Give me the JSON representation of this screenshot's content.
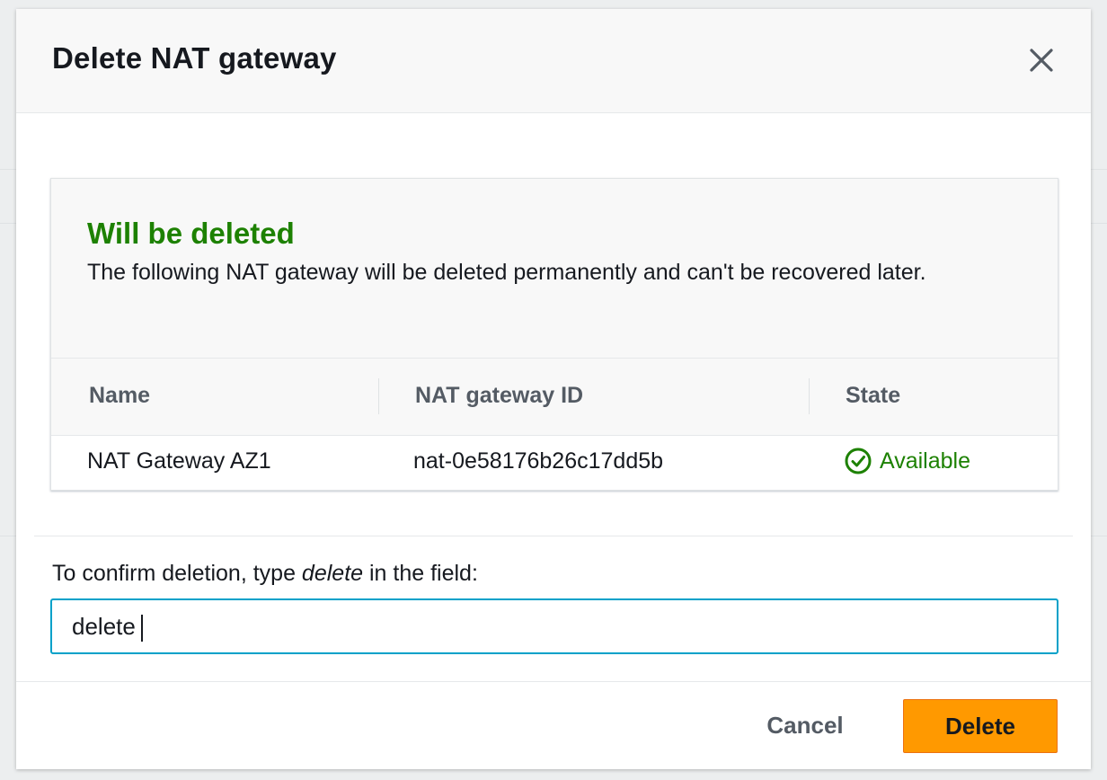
{
  "modal": {
    "title": "Delete NAT gateway",
    "close_icon": "close-icon"
  },
  "warning": {
    "heading": "Will be deleted",
    "description": "The following NAT gateway will be deleted permanently and can't be recovered later.",
    "heading_color": "#1d8102"
  },
  "table": {
    "columns": [
      "Name",
      "NAT gateway ID",
      "State"
    ],
    "rows": [
      {
        "name": "NAT Gateway AZ1",
        "id": "nat-0e58176b26c17dd5b",
        "state": "Available",
        "state_icon": "check-circle-icon",
        "state_color": "#1d8102"
      }
    ]
  },
  "confirm": {
    "label_prefix": "To confirm deletion, type ",
    "label_keyword": "delete",
    "label_suffix": " in the field:",
    "input_value": "delete"
  },
  "footer": {
    "cancel_label": "Cancel",
    "delete_label": "Delete",
    "delete_color": "#ff9900"
  }
}
